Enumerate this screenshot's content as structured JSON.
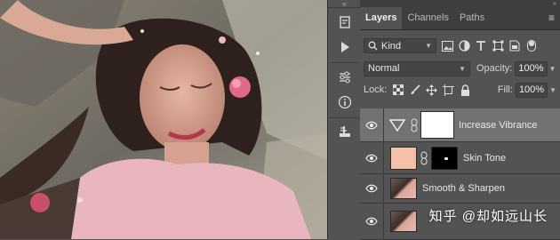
{
  "toolbar": {
    "collapse_glyph": "«",
    "collapse_glyph_right": "»",
    "icons": [
      "history-icon",
      "play-action-icon",
      "adjustments-icon",
      "info-icon",
      "properties-icon"
    ]
  },
  "panel": {
    "tabs": [
      {
        "label": "Layers",
        "active": true
      },
      {
        "label": "Channels",
        "active": false
      },
      {
        "label": "Paths",
        "active": false
      }
    ],
    "menu_glyph": "≡",
    "filter": {
      "kind_label": "Kind"
    },
    "blend": {
      "mode": "Normal",
      "opacity_label": "Opacity:",
      "opacity_value": "100%"
    },
    "lock": {
      "label": "Lock:",
      "fill_label": "Fill:",
      "fill_value": "100%"
    },
    "layers": [
      {
        "name": "Increase Vibrance",
        "selected": true
      },
      {
        "name": "Skin Tone",
        "selected": false
      },
      {
        "name": "Smooth & Sharpen",
        "selected": false
      },
      {
        "name": "",
        "selected": false
      }
    ]
  },
  "watermark": {
    "text": "知乎 @却如远山长"
  },
  "colors": {
    "panel_bg": "#535353",
    "selected_layer": "#727272",
    "skin_swatch": "#f2c1a8"
  }
}
